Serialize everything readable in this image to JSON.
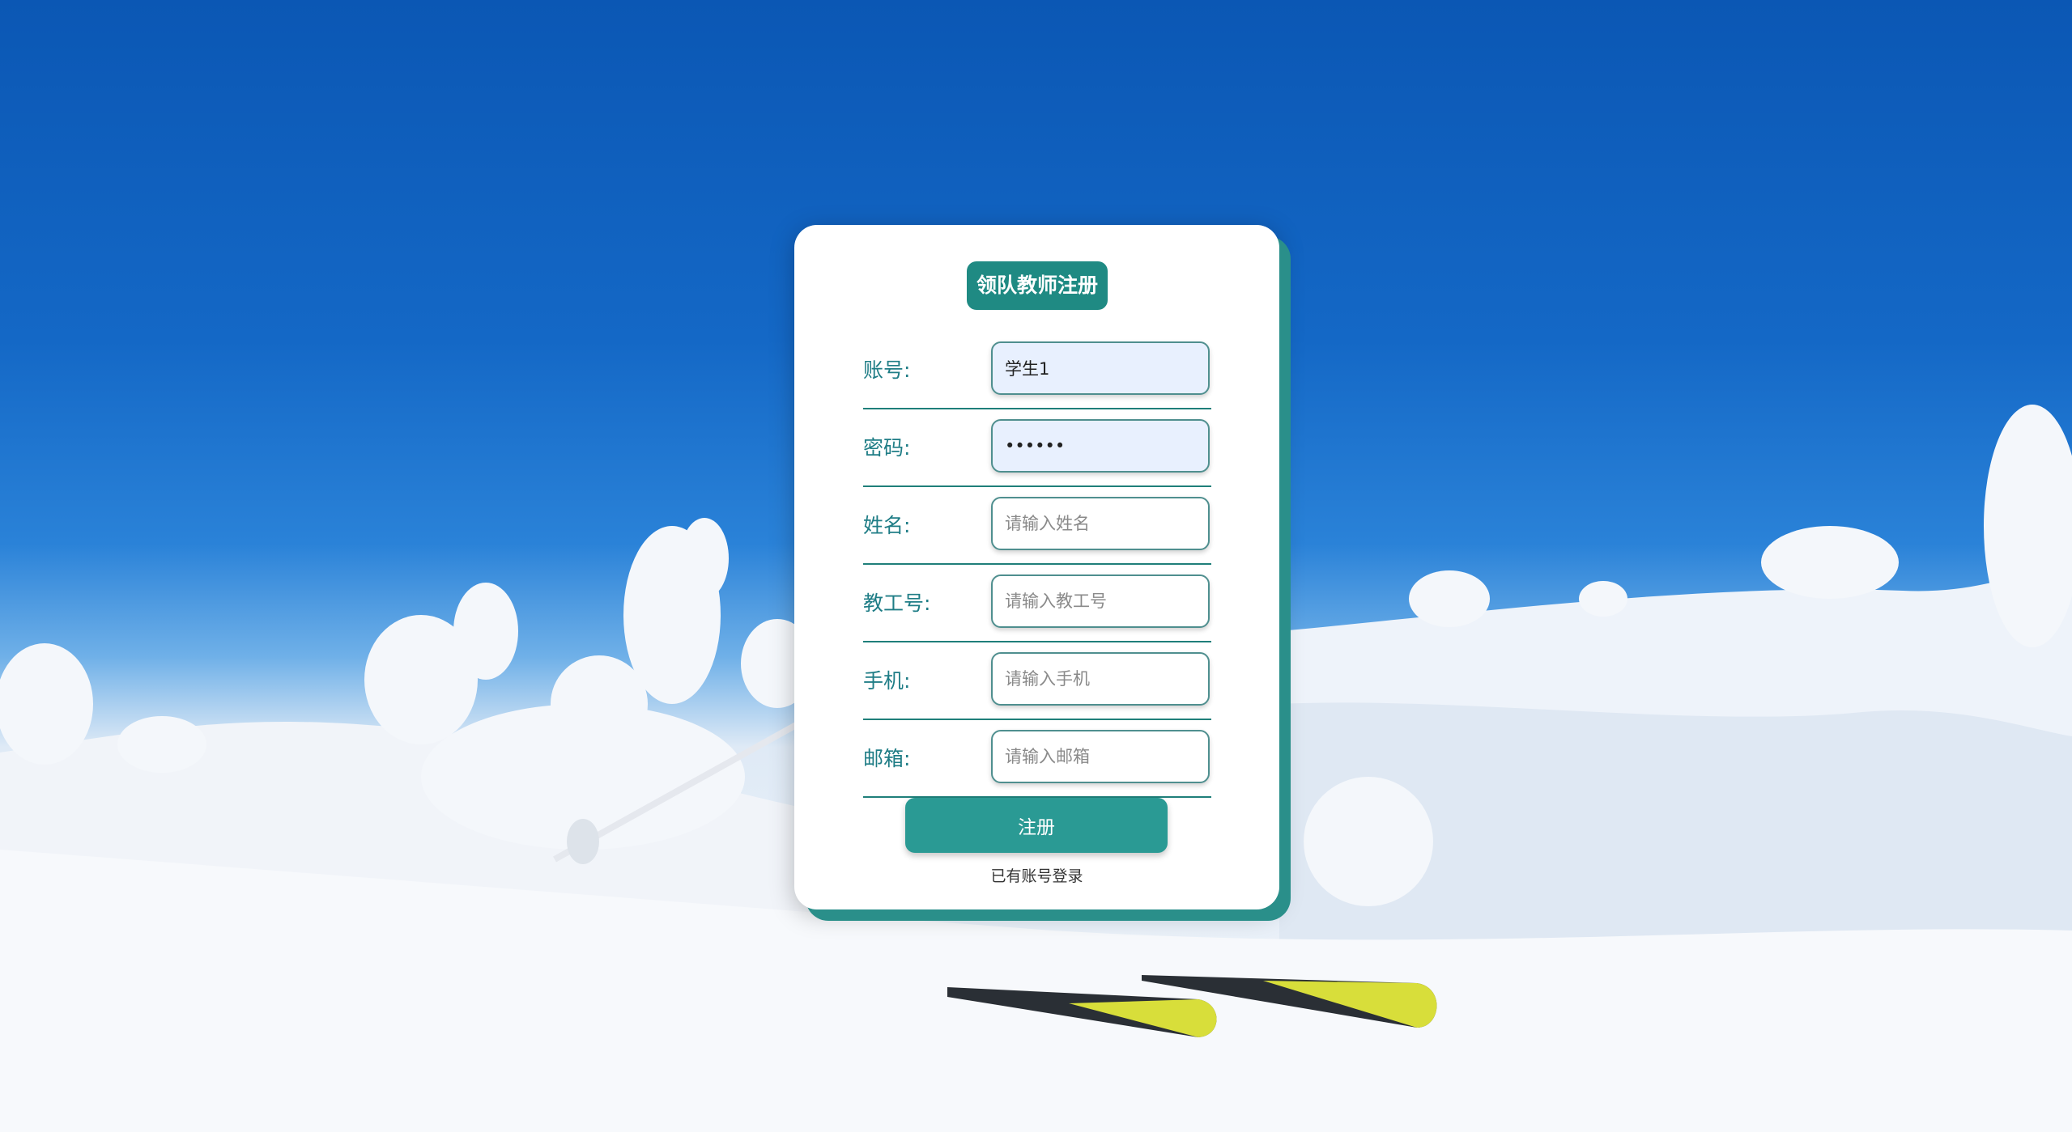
{
  "form": {
    "title": "领队教师注册",
    "fields": [
      {
        "label": "账号:",
        "value": "学生1",
        "placeholder": "",
        "type": "text"
      },
      {
        "label": "密码:",
        "value": "••••••",
        "placeholder": "",
        "type": "password"
      },
      {
        "label": "姓名:",
        "value": "",
        "placeholder": "请输入姓名",
        "type": "text"
      },
      {
        "label": "教工号:",
        "value": "",
        "placeholder": "请输入教工号",
        "type": "text"
      },
      {
        "label": "手机:",
        "value": "",
        "placeholder": "请输入手机",
        "type": "text"
      },
      {
        "label": "邮箱:",
        "value": "",
        "placeholder": "请输入邮箱",
        "type": "text"
      }
    ],
    "submit_label": "注册",
    "login_link": "已有账号登录"
  },
  "colors": {
    "accent": "#1f8a83",
    "button": "#2a9a94",
    "label_text": "#1f7d86",
    "autofill_bg": "#e8f0fe"
  }
}
